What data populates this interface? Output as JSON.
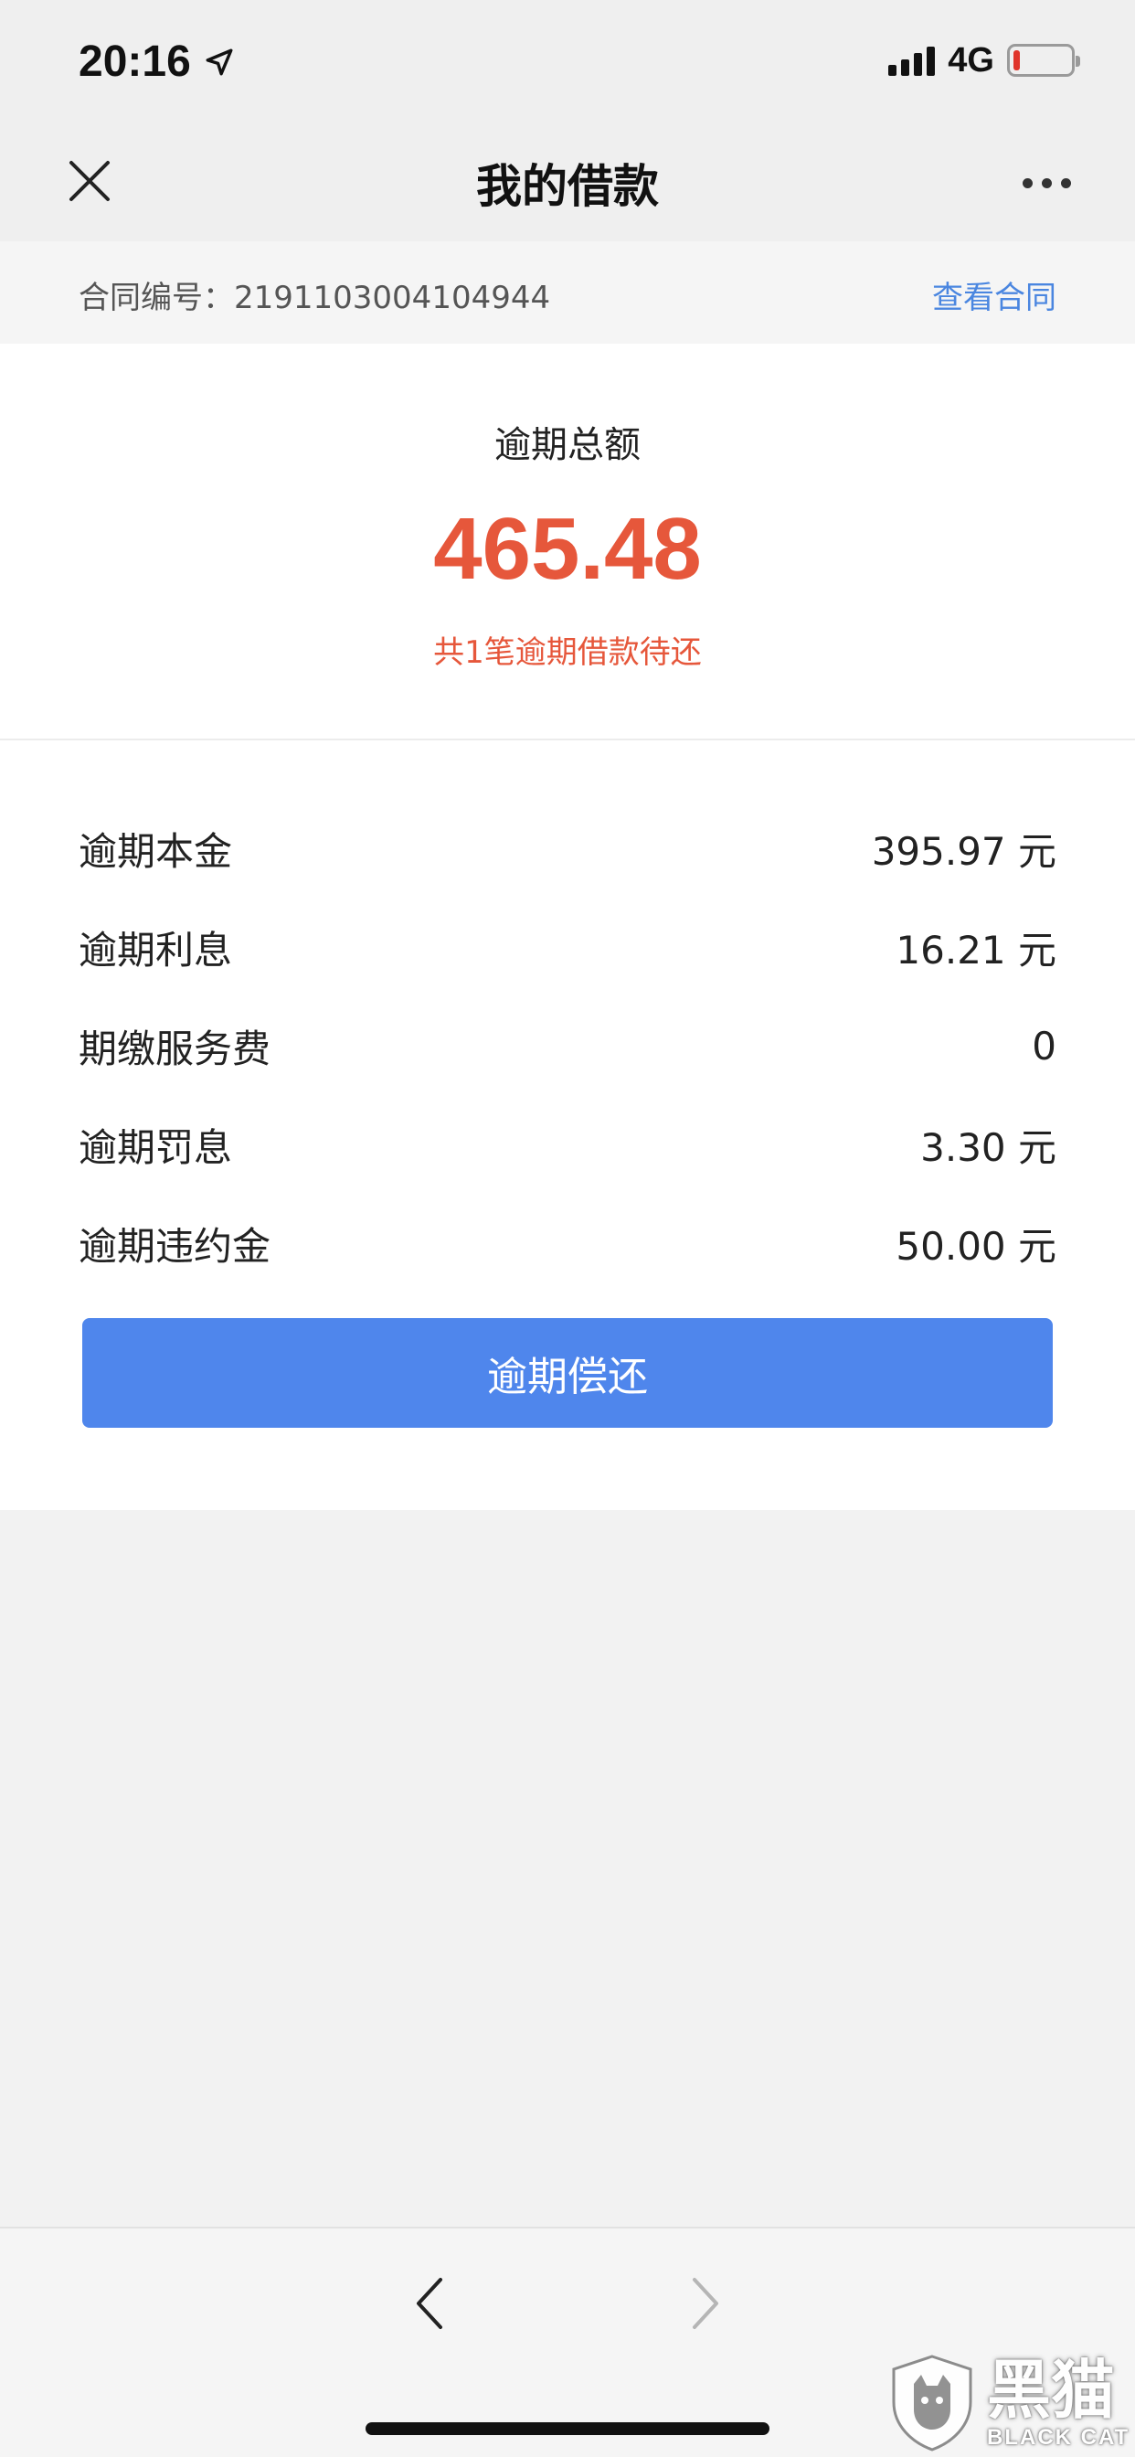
{
  "status_bar": {
    "time": "20:16",
    "network": "4G"
  },
  "navbar": {
    "title": "我的借款"
  },
  "contract": {
    "label": "合同编号：2191103004104944",
    "view_link": "查看合同"
  },
  "summary": {
    "label": "逾期总额",
    "amount": "465.48",
    "subtitle": "共1笔逾期借款待还"
  },
  "details": [
    {
      "key": "逾期本金",
      "value": "395.97 元"
    },
    {
      "key": "逾期利息",
      "value": "16.21 元"
    },
    {
      "key": "期缴服务费",
      "value": "0"
    },
    {
      "key": "逾期罚息",
      "value": "3.30 元"
    },
    {
      "key": "逾期违约金",
      "value": "50.00 元"
    }
  ],
  "actions": {
    "pay_button": "逾期偿还"
  },
  "watermark": {
    "cn": "黑猫",
    "en": "BLACK CAT"
  },
  "colors": {
    "accent_red": "#e6573b",
    "link_blue": "#4a86e0",
    "button_blue": "#4f86ec"
  }
}
